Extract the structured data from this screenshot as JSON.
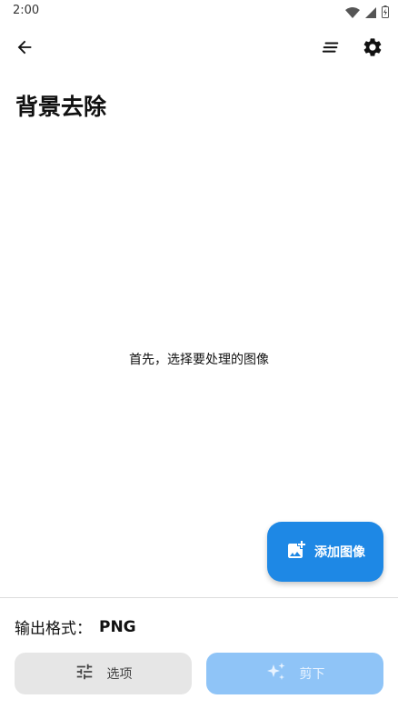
{
  "status_bar": {
    "time": "2:00",
    "icons": [
      "wifi-icon",
      "signal-icon",
      "battery-icon"
    ]
  },
  "toolbar": {
    "icons": [
      "back-arrow-icon",
      "sort-icon",
      "gear-icon"
    ]
  },
  "page": {
    "title": "背景去除",
    "empty_hint": "首先，选择要处理的图像"
  },
  "fab": {
    "label": "添加图像",
    "icon": "add-photo-icon",
    "color": "#1e88e5"
  },
  "footer": {
    "format_label": "输出格式：",
    "format_value": "PNG",
    "options_label": "选项",
    "options_icon": "tune-icon",
    "cut_label": "剪下",
    "cut_icon": "sparkle-icon",
    "cut_color": "#8fc4f7"
  }
}
